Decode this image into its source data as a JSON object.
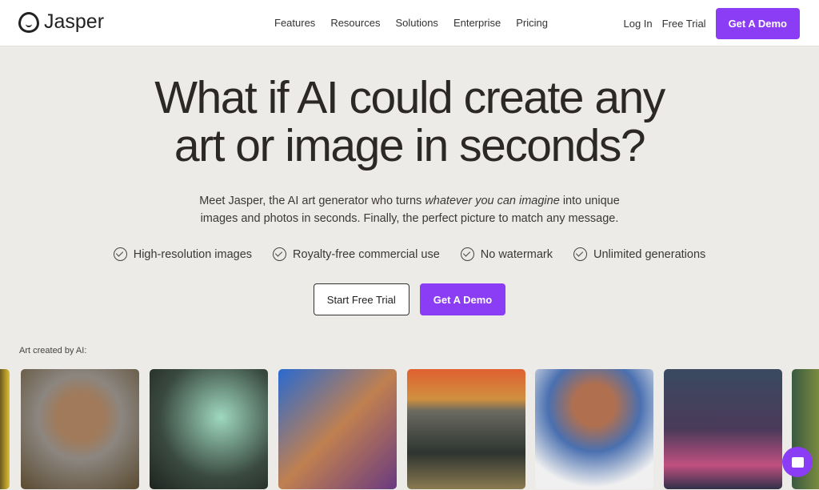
{
  "nav": {
    "brand": "Jasper",
    "links": [
      "Features",
      "Resources",
      "Solutions",
      "Enterprise",
      "Pricing"
    ],
    "login": "Log In",
    "free_trial": "Free Trial",
    "demo": "Get A Demo"
  },
  "hero": {
    "title_line1": "What if AI could create any",
    "title_line2": "art or image in seconds?",
    "sub_a": "Meet Jasper, the AI art generator who turns ",
    "sub_em": "whatever you can imagine",
    "sub_b": " into unique",
    "sub_line2": "images and photos in seconds. Finally, the perfect picture to match any message.",
    "features": [
      "High-resolution images",
      "Royalty-free commercial use",
      "No watermark",
      "Unlimited generations"
    ],
    "cta_trial": "Start Free Trial",
    "cta_demo": "Get A Demo"
  },
  "gallery": {
    "label": "Art created by AI:",
    "images": [
      "partial-yellow",
      "bearded-king",
      "forest-creature",
      "corgi-running",
      "ocean-sunset",
      "man-with-kittens",
      "neon-city-street",
      "partial-green"
    ]
  },
  "colors": {
    "accent": "#8b3cf5",
    "background": "#ecebe8"
  }
}
